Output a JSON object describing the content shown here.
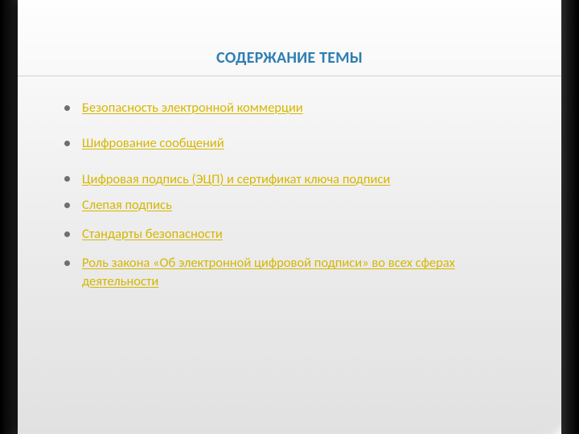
{
  "title": "СОДЕРЖАНИЕ ТЕМЫ",
  "items": [
    {
      "label": "Безопасность электронной коммерции"
    },
    {
      "label": "Шифрование сообщений"
    },
    {
      "label": "Цифровая подпись (ЭЦП) и сертификат ключа подписи"
    },
    {
      "label": "Слепая подпись"
    },
    {
      "label": "Стандарты безопасности"
    },
    {
      "label": "Роль закона «Об электронной цифровой подписи» во всех сферах деятельности"
    }
  ]
}
